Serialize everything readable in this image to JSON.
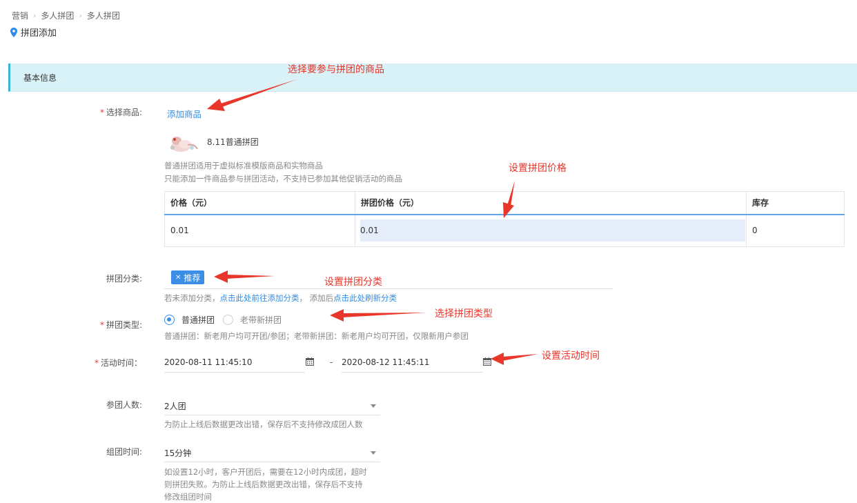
{
  "breadcrumb": {
    "items": [
      "营销",
      "多人拼团",
      "多人拼团"
    ]
  },
  "page_title": "拼团添加",
  "section_title": "基本信息",
  "form": {
    "product": {
      "label": "选择商品:",
      "add_link": "添加商品",
      "product_name": "8.11普通拼团",
      "hint1": "普通拼团适用于虚拟标准模版商品和实物商品",
      "hint2": "只能添加一件商品参与拼团活动，不支持已参加其他促销活动的商品"
    },
    "table": {
      "headers": [
        "价格（元）",
        "拼团价格（元）",
        "库存"
      ],
      "row": {
        "price": "0.01",
        "group_price": "0.01",
        "stock": "0"
      }
    },
    "category": {
      "label": "拼团分类:",
      "tag": "推荐",
      "hint_prefix": "若未添加分类，",
      "hint_link1": "点击此处前往添加分类",
      "hint_mid": "， 添加后",
      "hint_link2": "点击此处刷新分类"
    },
    "type": {
      "label": "拼团类型:",
      "options": [
        "普通拼团",
        "老带新拼团"
      ],
      "selected": 0,
      "hint": "普通拼团：新老用户均可开团/参团；老带新拼团：新老用户均可开团，仅限新用户参团"
    },
    "time": {
      "label": "活动时间：",
      "start": "2020-08-11 11:45:10",
      "end": "2020-08-12 11:45:11",
      "separator": "-"
    },
    "members": {
      "label": "参团人数:",
      "value": "2人团",
      "hint": "为防止上线后数据更改出错，保存后不支持修改成团人数"
    },
    "duration": {
      "label": "组团时间:",
      "value": "15分钟",
      "hint_lines": [
        "如设置12小时，客户开团后，需要在12小时内成团，超时",
        "则拼团失败。为防止上线后数据更改出错，保存后不支持",
        "修改组团时间"
      ]
    }
  },
  "annotations": {
    "select_product": "选择要参与拼团的商品",
    "set_price": "设置拼团价格",
    "set_category": "设置拼团分类",
    "select_type": "选择拼团类型",
    "set_time": "设置活动时间"
  },
  "colors": {
    "accent": "#3a8ee6",
    "annotation": "#e9362a",
    "section_bg": "#d8f2f7"
  },
  "required_mark": "*"
}
